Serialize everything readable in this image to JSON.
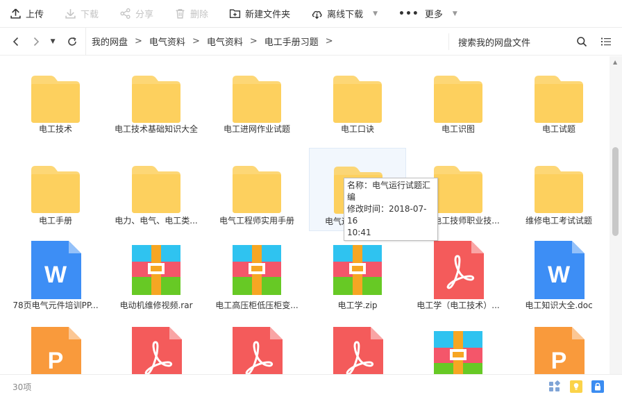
{
  "toolbar": {
    "upload": "上传",
    "download": "下载",
    "share": "分享",
    "delete": "删除",
    "new_folder": "新建文件夹",
    "offline_download": "离线下载",
    "more": "更多"
  },
  "breadcrumb": [
    "我的网盘",
    "电气资料",
    "电气资料",
    "电工手册习题"
  ],
  "search": {
    "placeholder": "搜索我的网盘文件"
  },
  "files": [
    {
      "name": "电工技术",
      "type": "folder"
    },
    {
      "name": "电工技术基础知识大全",
      "type": "folder"
    },
    {
      "name": "电工进网作业试题",
      "type": "folder"
    },
    {
      "name": "电工口诀",
      "type": "folder"
    },
    {
      "name": "电工识图",
      "type": "folder"
    },
    {
      "name": "电工试题",
      "type": "folder"
    },
    {
      "name": "电工手册",
      "type": "folder"
    },
    {
      "name": "电力、电气、电工类...",
      "type": "folder"
    },
    {
      "name": "电气工程师实用手册",
      "type": "folder"
    },
    {
      "name": "电气运行试题汇编",
      "type": "folder"
    },
    {
      "name": "维修电工技师职业技...",
      "type": "folder"
    },
    {
      "name": "维修电工考试试题",
      "type": "folder"
    },
    {
      "name": "78页电气元件培训PP...",
      "type": "word"
    },
    {
      "name": "电动机维修视频.rar",
      "type": "rar"
    },
    {
      "name": "电工高压柜低压柜变...",
      "type": "rar"
    },
    {
      "name": "电工学.zip",
      "type": "rar"
    },
    {
      "name": "电工学（电工技术）...",
      "type": "pdf"
    },
    {
      "name": "电工知识大全.doc",
      "type": "word"
    },
    {
      "name": "",
      "type": "ppt"
    },
    {
      "name": "",
      "type": "pdf"
    },
    {
      "name": "",
      "type": "pdf"
    },
    {
      "name": "",
      "type": "pdf"
    },
    {
      "name": "",
      "type": "rar"
    },
    {
      "name": "",
      "type": "ppt"
    }
  ],
  "tooltip": {
    "line1": "名称：电气运行试题汇编",
    "line2": "修改时间：2018-07-16",
    "line3": "10:41"
  },
  "status": {
    "count": "30项"
  },
  "colors": {
    "folder": "#fdd05e",
    "word": "#3d8ef5",
    "pdf": "#f45b5b",
    "ppt": "#f99a3c",
    "accent": "#3b8cf1"
  }
}
